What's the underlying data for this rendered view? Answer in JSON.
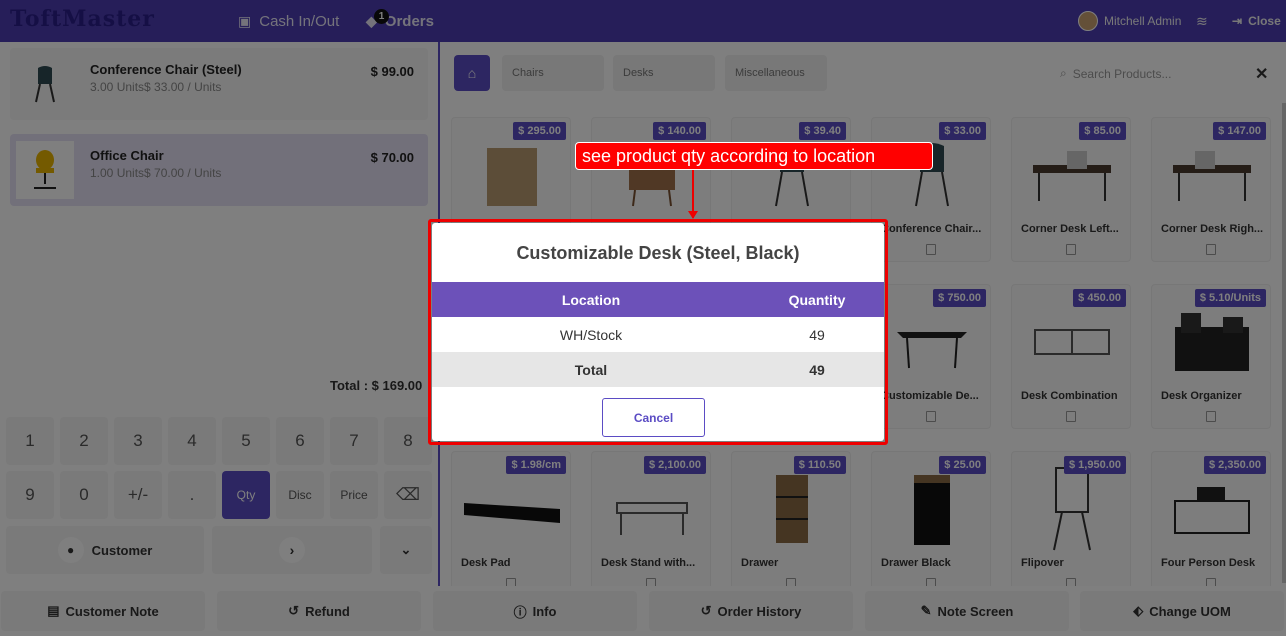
{
  "topbar": {
    "logo": "ToftMaster",
    "cash_label": "Cash In/Out",
    "orders_label": "Orders",
    "orders_count": "1",
    "user_name": "Mitchell Admin",
    "close_label": "Close"
  },
  "order": {
    "lines": [
      {
        "name": "Conference Chair (Steel)",
        "qty": "3.00 Units$ 33.00 / Units",
        "price": "$ 99.00"
      },
      {
        "name": "Office Chair",
        "qty": "1.00 Units$ 70.00 / Units",
        "price": "$ 70.00"
      }
    ],
    "total": "Total : $ 169.00"
  },
  "numpad": {
    "row1": [
      "1",
      "2",
      "3",
      "4",
      "5",
      "6",
      "7",
      "8"
    ],
    "row2": [
      "9",
      "0",
      "+/-",
      ".",
      "Qty",
      "Disc",
      "Price",
      "⌫"
    ],
    "customer": "Customer"
  },
  "categories": {
    "items": [
      "Chairs",
      "Desks",
      "Miscellaneous"
    ],
    "search_placeholder": "Search Products..."
  },
  "products": [
    {
      "name": "",
      "price": "$ 295.00"
    },
    {
      "name": "",
      "price": "$ 140.00"
    },
    {
      "name": "",
      "price": "$ 39.40"
    },
    {
      "name": "Conference Chair...",
      "price": "$ 33.00"
    },
    {
      "name": "Corner Desk Left...",
      "price": "$ 85.00"
    },
    {
      "name": "Corner Desk Righ...",
      "price": "$ 147.00"
    },
    {
      "name": "Customizable De...",
      "price": "$ 750.00"
    },
    {
      "name": "Desk Combination",
      "price": "$ 450.00"
    },
    {
      "name": "Desk Organizer",
      "price": "$ 5.10/Units"
    },
    {
      "name": "Desk Pad",
      "price": "$ 1.98/cm"
    },
    {
      "name": "Desk Stand with...",
      "price": "$ 2,100.00"
    },
    {
      "name": "Drawer",
      "price": "$ 110.50"
    },
    {
      "name": "Drawer Black",
      "price": "$ 25.00"
    },
    {
      "name": "Flipover",
      "price": "$ 1,950.00"
    },
    {
      "name": "Four Person Desk",
      "price": "$ 2,350.00"
    }
  ],
  "bottom": {
    "customer_note": "Customer Note",
    "refund": "Refund",
    "info": "Info",
    "order_history": "Order History",
    "note_screen": "Note Screen",
    "change_uom": "Change UOM"
  },
  "modal": {
    "title": "Customizable Desk (Steel, Black)",
    "col_location": "Location",
    "col_quantity": "Quantity",
    "rows": [
      {
        "location": "WH/Stock",
        "quantity": "49"
      }
    ],
    "total_label": "Total",
    "total_value": "49",
    "cancel": "Cancel"
  },
  "callout": "see product qty according to location",
  "colors": {
    "accent": "#5b4cc4",
    "header": "#4c3db3",
    "callout": "#ff0000"
  }
}
